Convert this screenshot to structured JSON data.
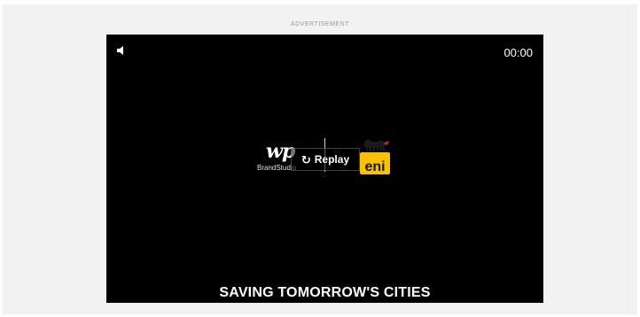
{
  "ad": {
    "label": "ADVERTISEMENT"
  },
  "player": {
    "timer": "00:00",
    "mute_icon": "speaker-icon",
    "replay_icon": "replay-icon",
    "replay_label": "Replay",
    "caption": "SAVING TOMORROW'S CITIES",
    "colors": {
      "background": "#000000",
      "text": "#ffffff",
      "eni_yellow": "#f9c200"
    }
  },
  "sponsors": {
    "wp_mark": "wp",
    "wp_sub": "BrandStudio",
    "eni_wordmark": "eni"
  }
}
